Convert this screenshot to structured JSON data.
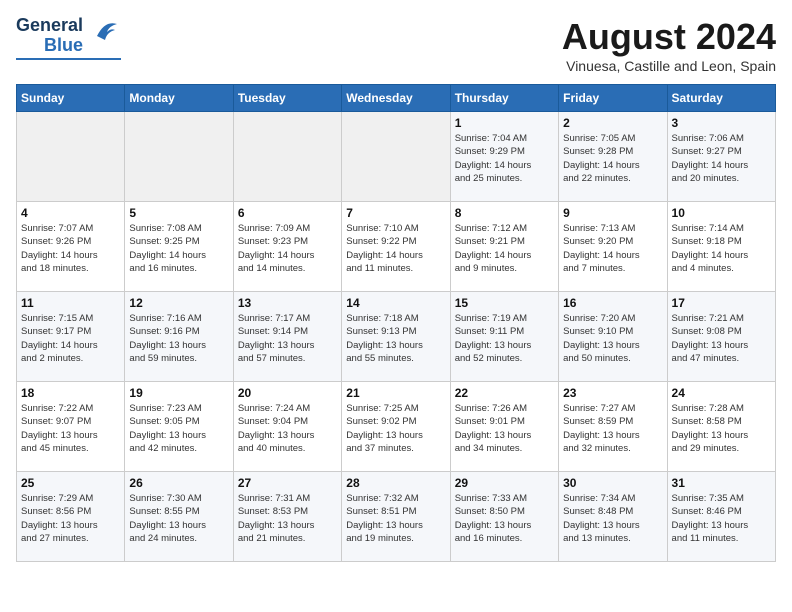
{
  "logo": {
    "general": "General",
    "blue": "Blue"
  },
  "title": "August 2024",
  "subtitle": "Vinuesa, Castille and Leon, Spain",
  "headers": [
    "Sunday",
    "Monday",
    "Tuesday",
    "Wednesday",
    "Thursday",
    "Friday",
    "Saturday"
  ],
  "weeks": [
    [
      {
        "day": "",
        "info": ""
      },
      {
        "day": "",
        "info": ""
      },
      {
        "day": "",
        "info": ""
      },
      {
        "day": "",
        "info": ""
      },
      {
        "day": "1",
        "info": "Sunrise: 7:04 AM\nSunset: 9:29 PM\nDaylight: 14 hours\nand 25 minutes."
      },
      {
        "day": "2",
        "info": "Sunrise: 7:05 AM\nSunset: 9:28 PM\nDaylight: 14 hours\nand 22 minutes."
      },
      {
        "day": "3",
        "info": "Sunrise: 7:06 AM\nSunset: 9:27 PM\nDaylight: 14 hours\nand 20 minutes."
      }
    ],
    [
      {
        "day": "4",
        "info": "Sunrise: 7:07 AM\nSunset: 9:26 PM\nDaylight: 14 hours\nand 18 minutes."
      },
      {
        "day": "5",
        "info": "Sunrise: 7:08 AM\nSunset: 9:25 PM\nDaylight: 14 hours\nand 16 minutes."
      },
      {
        "day": "6",
        "info": "Sunrise: 7:09 AM\nSunset: 9:23 PM\nDaylight: 14 hours\nand 14 minutes."
      },
      {
        "day": "7",
        "info": "Sunrise: 7:10 AM\nSunset: 9:22 PM\nDaylight: 14 hours\nand 11 minutes."
      },
      {
        "day": "8",
        "info": "Sunrise: 7:12 AM\nSunset: 9:21 PM\nDaylight: 14 hours\nand 9 minutes."
      },
      {
        "day": "9",
        "info": "Sunrise: 7:13 AM\nSunset: 9:20 PM\nDaylight: 14 hours\nand 7 minutes."
      },
      {
        "day": "10",
        "info": "Sunrise: 7:14 AM\nSunset: 9:18 PM\nDaylight: 14 hours\nand 4 minutes."
      }
    ],
    [
      {
        "day": "11",
        "info": "Sunrise: 7:15 AM\nSunset: 9:17 PM\nDaylight: 14 hours\nand 2 minutes."
      },
      {
        "day": "12",
        "info": "Sunrise: 7:16 AM\nSunset: 9:16 PM\nDaylight: 13 hours\nand 59 minutes."
      },
      {
        "day": "13",
        "info": "Sunrise: 7:17 AM\nSunset: 9:14 PM\nDaylight: 13 hours\nand 57 minutes."
      },
      {
        "day": "14",
        "info": "Sunrise: 7:18 AM\nSunset: 9:13 PM\nDaylight: 13 hours\nand 55 minutes."
      },
      {
        "day": "15",
        "info": "Sunrise: 7:19 AM\nSunset: 9:11 PM\nDaylight: 13 hours\nand 52 minutes."
      },
      {
        "day": "16",
        "info": "Sunrise: 7:20 AM\nSunset: 9:10 PM\nDaylight: 13 hours\nand 50 minutes."
      },
      {
        "day": "17",
        "info": "Sunrise: 7:21 AM\nSunset: 9:08 PM\nDaylight: 13 hours\nand 47 minutes."
      }
    ],
    [
      {
        "day": "18",
        "info": "Sunrise: 7:22 AM\nSunset: 9:07 PM\nDaylight: 13 hours\nand 45 minutes."
      },
      {
        "day": "19",
        "info": "Sunrise: 7:23 AM\nSunset: 9:05 PM\nDaylight: 13 hours\nand 42 minutes."
      },
      {
        "day": "20",
        "info": "Sunrise: 7:24 AM\nSunset: 9:04 PM\nDaylight: 13 hours\nand 40 minutes."
      },
      {
        "day": "21",
        "info": "Sunrise: 7:25 AM\nSunset: 9:02 PM\nDaylight: 13 hours\nand 37 minutes."
      },
      {
        "day": "22",
        "info": "Sunrise: 7:26 AM\nSunset: 9:01 PM\nDaylight: 13 hours\nand 34 minutes."
      },
      {
        "day": "23",
        "info": "Sunrise: 7:27 AM\nSunset: 8:59 PM\nDaylight: 13 hours\nand 32 minutes."
      },
      {
        "day": "24",
        "info": "Sunrise: 7:28 AM\nSunset: 8:58 PM\nDaylight: 13 hours\nand 29 minutes."
      }
    ],
    [
      {
        "day": "25",
        "info": "Sunrise: 7:29 AM\nSunset: 8:56 PM\nDaylight: 13 hours\nand 27 minutes."
      },
      {
        "day": "26",
        "info": "Sunrise: 7:30 AM\nSunset: 8:55 PM\nDaylight: 13 hours\nand 24 minutes."
      },
      {
        "day": "27",
        "info": "Sunrise: 7:31 AM\nSunset: 8:53 PM\nDaylight: 13 hours\nand 21 minutes."
      },
      {
        "day": "28",
        "info": "Sunrise: 7:32 AM\nSunset: 8:51 PM\nDaylight: 13 hours\nand 19 minutes."
      },
      {
        "day": "29",
        "info": "Sunrise: 7:33 AM\nSunset: 8:50 PM\nDaylight: 13 hours\nand 16 minutes."
      },
      {
        "day": "30",
        "info": "Sunrise: 7:34 AM\nSunset: 8:48 PM\nDaylight: 13 hours\nand 13 minutes."
      },
      {
        "day": "31",
        "info": "Sunrise: 7:35 AM\nSunset: 8:46 PM\nDaylight: 13 hours\nand 11 minutes."
      }
    ]
  ]
}
